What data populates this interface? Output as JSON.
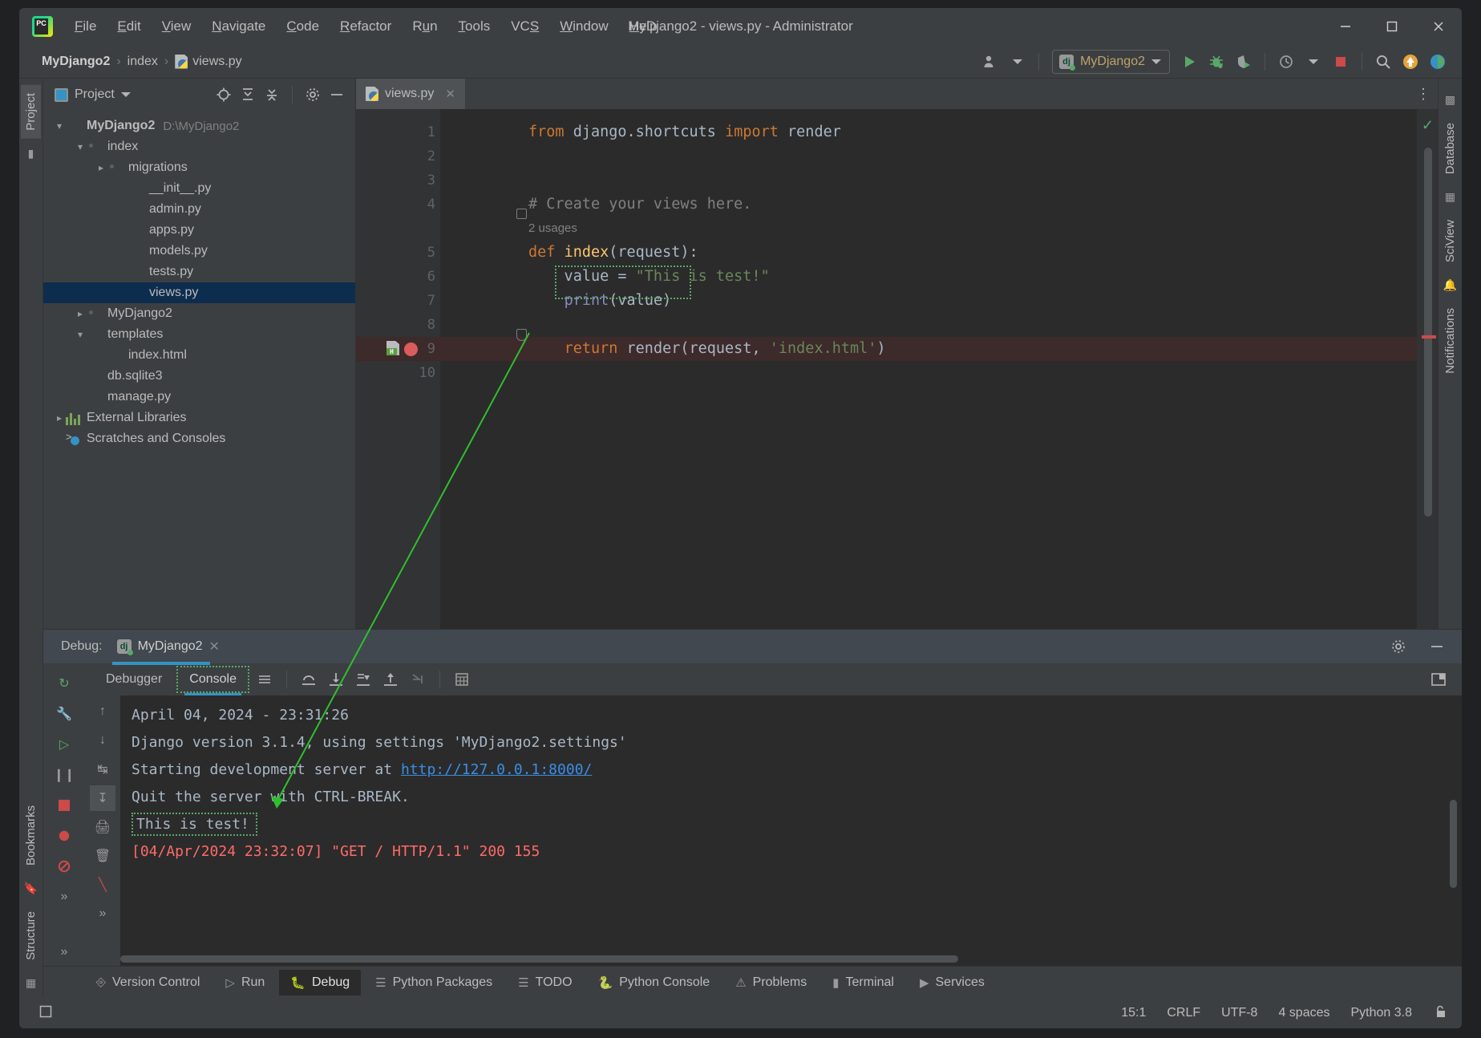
{
  "window": {
    "title": "MyDjango2 - views.py - Administrator",
    "app_icon": "pycharm-logo-icon",
    "minimize": "minimize-icon",
    "maximize": "maximize-icon",
    "close": "close-icon"
  },
  "menu": [
    {
      "label": "File"
    },
    {
      "label": "Edit"
    },
    {
      "label": "View"
    },
    {
      "label": "Navigate"
    },
    {
      "label": "Code"
    },
    {
      "label": "Refactor"
    },
    {
      "label": "Run"
    },
    {
      "label": "Tools"
    },
    {
      "label": "VCS"
    },
    {
      "label": "Window"
    },
    {
      "label": "Help"
    }
  ],
  "breadcrumb": {
    "items": [
      "MyDjango2",
      "index",
      "views.py"
    ],
    "separator": "›"
  },
  "toolbar": {
    "account_icon": "user-account-icon",
    "run_config": "MyDjango2",
    "run_config_icon": "django-icon",
    "run_icon": "run-play-icon",
    "debug_icon": "debug-bug-icon",
    "coverage_icon": "run-with-coverage-icon",
    "profile_icon": "profile-icon",
    "stop_icon": "stop-square-icon",
    "search_icon": "search-everywhere-icon",
    "updates_icon": "update-arrow-icon",
    "ide_icon": "ide-feature-icon"
  },
  "left_stripe": {
    "project_tab": "Project",
    "bookmarks_tab": "Bookmarks",
    "structure_tab": "Structure"
  },
  "right_stripe": {
    "database_tab": "Database",
    "sciview_tab": "SciView",
    "notifications_tab": "Notifications"
  },
  "project": {
    "title": "Project",
    "tools": [
      "select-opened-file-icon",
      "expand-all-icon",
      "collapse-all-icon",
      "settings-gear-icon",
      "hide-panel-icon"
    ],
    "tree": [
      {
        "label": "MyDjango2",
        "path": "D:\\MyDjango2",
        "icon": "folder-icon",
        "arrow": "chevron-down",
        "indent": 0,
        "bold": true,
        "selected": false
      },
      {
        "label": "index",
        "path": "",
        "icon": "folder-package-icon",
        "arrow": "chevron-down",
        "indent": 1,
        "bold": false,
        "selected": false
      },
      {
        "label": "migrations",
        "path": "",
        "icon": "folder-package-icon",
        "arrow": "chevron-right",
        "indent": 2,
        "bold": false,
        "selected": false
      },
      {
        "label": "__init__.py",
        "path": "",
        "icon": "python-file-icon",
        "arrow": "",
        "indent": 3,
        "bold": false,
        "selected": false
      },
      {
        "label": "admin.py",
        "path": "",
        "icon": "python-file-icon",
        "arrow": "",
        "indent": 3,
        "bold": false,
        "selected": false
      },
      {
        "label": "apps.py",
        "path": "",
        "icon": "python-file-icon",
        "arrow": "",
        "indent": 3,
        "bold": false,
        "selected": false
      },
      {
        "label": "models.py",
        "path": "",
        "icon": "python-file-icon",
        "arrow": "",
        "indent": 3,
        "bold": false,
        "selected": false
      },
      {
        "label": "tests.py",
        "path": "",
        "icon": "python-file-icon",
        "arrow": "",
        "indent": 3,
        "bold": false,
        "selected": false
      },
      {
        "label": "views.py",
        "path": "",
        "icon": "python-file-icon",
        "arrow": "",
        "indent": 3,
        "bold": false,
        "selected": true
      },
      {
        "label": "MyDjango2",
        "path": "",
        "icon": "folder-package-icon",
        "arrow": "chevron-right",
        "indent": 1,
        "bold": false,
        "selected": false
      },
      {
        "label": "templates",
        "path": "",
        "icon": "folder-purple-icon",
        "arrow": "chevron-down",
        "indent": 1,
        "bold": false,
        "selected": false
      },
      {
        "label": "index.html",
        "path": "",
        "icon": "html-file-icon",
        "arrow": "",
        "indent": 2,
        "bold": false,
        "selected": false
      },
      {
        "label": "db.sqlite3",
        "path": "",
        "icon": "database-file-icon",
        "arrow": "",
        "indent": 1,
        "bold": false,
        "selected": false
      },
      {
        "label": "manage.py",
        "path": "",
        "icon": "python-file-icon",
        "arrow": "",
        "indent": 1,
        "bold": false,
        "selected": false
      },
      {
        "label": "External Libraries",
        "path": "",
        "icon": "libraries-icon",
        "arrow": "chevron-right",
        "indent": 0,
        "bold": false,
        "selected": false
      },
      {
        "label": "Scratches and Consoles",
        "path": "",
        "icon": "scratches-icon",
        "arrow": "",
        "indent": 0,
        "bold": false,
        "selected": false
      }
    ]
  },
  "editor": {
    "tab": {
      "label": "views.py",
      "icon": "python-file-icon",
      "close": "close-tab-icon"
    },
    "inspection_status": "check-ok-icon",
    "gutter_line_numbers": [
      "1",
      "2",
      "3",
      "4",
      "5",
      "6",
      "7",
      "8",
      "9",
      "10"
    ],
    "usages_hint": "2 usages",
    "breakpoint_line": 9,
    "breakpoint_icon": "breakpoint-red-dot-icon",
    "html_gutter_icon": "html-file-icon",
    "highlighted_selection": "print(value)",
    "lines": [
      {
        "n": 1,
        "tokens": [
          {
            "t": "from ",
            "c": "kw"
          },
          {
            "t": "django.shortcuts ",
            "c": "pl"
          },
          {
            "t": "import ",
            "c": "kw"
          },
          {
            "t": "render",
            "c": "pl"
          }
        ]
      },
      {
        "n": 2,
        "tokens": []
      },
      {
        "n": 3,
        "tokens": []
      },
      {
        "n": 4,
        "tokens": [
          {
            "t": "# Create your views here.",
            "c": "cmt"
          }
        ]
      },
      {
        "n": 5,
        "tokens": [
          {
            "t": "def ",
            "c": "kw"
          },
          {
            "t": "index",
            "c": "fn"
          },
          {
            "t": "(request):",
            "c": "pl"
          }
        ]
      },
      {
        "n": 6,
        "tokens": [
          {
            "t": "    value = ",
            "c": "pl"
          },
          {
            "t": "\"This is test!\"",
            "c": "str"
          }
        ]
      },
      {
        "n": 7,
        "tokens": [
          {
            "t": "    ",
            "c": "pl"
          },
          {
            "t": "print",
            "c": "bi"
          },
          {
            "t": "(value)",
            "c": "pl"
          }
        ]
      },
      {
        "n": 8,
        "tokens": []
      },
      {
        "n": 9,
        "tokens": [
          {
            "t": "    ",
            "c": "pl"
          },
          {
            "t": "return ",
            "c": "kw"
          },
          {
            "t": "render(request, ",
            "c": "pl"
          },
          {
            "t": "'index.html'",
            "c": "str"
          },
          {
            "t": ")",
            "c": "pl"
          }
        ]
      },
      {
        "n": 10,
        "tokens": []
      }
    ]
  },
  "debug": {
    "header_label": "Debug:",
    "session_name": "MyDjango2",
    "session_icon": "django-icon",
    "close_icon": "close-icon",
    "settings_icon": "settings-gear-icon",
    "hide_icon": "hide-panel-icon",
    "layout_icon": "layout-settings-icon",
    "tabs": [
      {
        "label": "Debugger",
        "active": false,
        "boxed": false
      },
      {
        "label": "Console",
        "active": true,
        "boxed": true
      }
    ],
    "toolbar_icons": [
      "lines-icon",
      "rerun-icon",
      "step-over-icon",
      "step-into-icon",
      "force-step-into-icon",
      "step-out-icon",
      "run-to-cursor-icon",
      "evaluate-icon"
    ],
    "side_icons": [
      "rerun-icon",
      "settings-wrench-icon",
      "resume-icon",
      "pause-icon",
      "stop-icon",
      "view-breakpoints-icon",
      "mute-breakpoints-icon",
      "more-icon"
    ],
    "console_side_icons": [
      "scroll-up-icon",
      "scroll-down-icon",
      "soft-wrap-icon",
      "scroll-to-end-icon",
      "print-icon",
      "clear-all-icon",
      "more-icon"
    ],
    "console_lines": [
      {
        "text": "April 04, 2024 - 23:31:26",
        "type": "plain"
      },
      {
        "text": "Django version 3.1.4, using settings 'MyDjango2.settings'",
        "type": "plain"
      },
      {
        "text": "Starting development server at http://127.0.0.1:8000/",
        "type": "link",
        "prefix": "Starting development server at ",
        "link": "http://127.0.0.1:8000/"
      },
      {
        "text": "Quit the server with CTRL-BREAK.",
        "type": "plain"
      },
      {
        "text": "This is test!",
        "type": "highlight"
      },
      {
        "text": "[04/Apr/2024 23:32:07] \"GET / HTTP/1.1\" 200 155",
        "type": "error"
      }
    ]
  },
  "tool_window_bar": [
    {
      "label": "Version Control",
      "icon": "branch-icon",
      "active": false
    },
    {
      "label": "Run",
      "icon": "run-play-icon",
      "active": false
    },
    {
      "label": "Debug",
      "icon": "debug-bug-icon",
      "active": true
    },
    {
      "label": "Python Packages",
      "icon": "packages-icon",
      "active": false
    },
    {
      "label": "TODO",
      "icon": "todo-list-icon",
      "active": false
    },
    {
      "label": "Python Console",
      "icon": "python-icon",
      "active": false
    },
    {
      "label": "Problems",
      "icon": "problems-icon",
      "active": false
    },
    {
      "label": "Terminal",
      "icon": "terminal-icon",
      "active": false
    },
    {
      "label": "Services",
      "icon": "services-icon",
      "active": false
    }
  ],
  "status_bar": {
    "left_icon": "tool-windows-icon",
    "caret_position": "15:1",
    "line_separator": "CRLF",
    "encoding": "UTF-8",
    "indent": "4 spaces",
    "interpreter": "Python 3.8",
    "lock_icon": "unlocked-icon"
  },
  "colors": {
    "accent_blue": "#3592c4",
    "green": "#59a869",
    "error_red": "#ff6b68",
    "keyword_orange": "#cc7832",
    "string_green": "#6a8759",
    "selection_navy": "#0d2d4e"
  }
}
